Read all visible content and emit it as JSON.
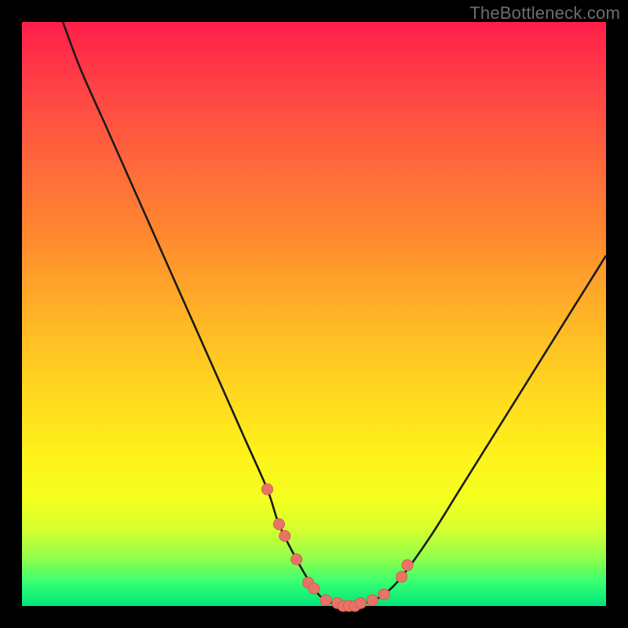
{
  "watermark": "TheBottleneck.com",
  "colors": {
    "curve_stroke": "#1a1a1a",
    "marker_fill": "#e87468",
    "marker_stroke": "#d85a4e",
    "gradient_top": "#ff1e4a",
    "gradient_bottom": "#00e57a",
    "background": "#000000"
  },
  "chart_data": {
    "type": "line",
    "title": "",
    "xlabel": "",
    "ylabel": "",
    "xlim": [
      0,
      100
    ],
    "ylim": [
      0,
      100
    ],
    "series": [
      {
        "name": "bottleneck-curve",
        "x": [
          7,
          10,
          14,
          18,
          22,
          26,
          30,
          34,
          38,
          42,
          44,
          47,
          50,
          52,
          55,
          57,
          60,
          62,
          65,
          70,
          75,
          80,
          85,
          90,
          95,
          100
        ],
        "y": [
          100,
          92,
          83,
          74,
          65,
          56,
          47,
          38,
          29,
          20,
          14,
          8,
          3,
          1,
          0,
          0,
          1,
          2,
          5,
          12,
          20,
          28,
          36,
          44,
          52,
          60
        ]
      }
    ],
    "markers": {
      "name": "highlight-points",
      "x": [
        42,
        44,
        45,
        47,
        49,
        50,
        52,
        54,
        55,
        56,
        57,
        58,
        60,
        62,
        65,
        66
      ],
      "y": [
        20,
        14,
        12,
        8,
        4,
        3,
        1,
        0.5,
        0,
        0,
        0,
        0.5,
        1,
        2,
        5,
        7
      ]
    }
  }
}
